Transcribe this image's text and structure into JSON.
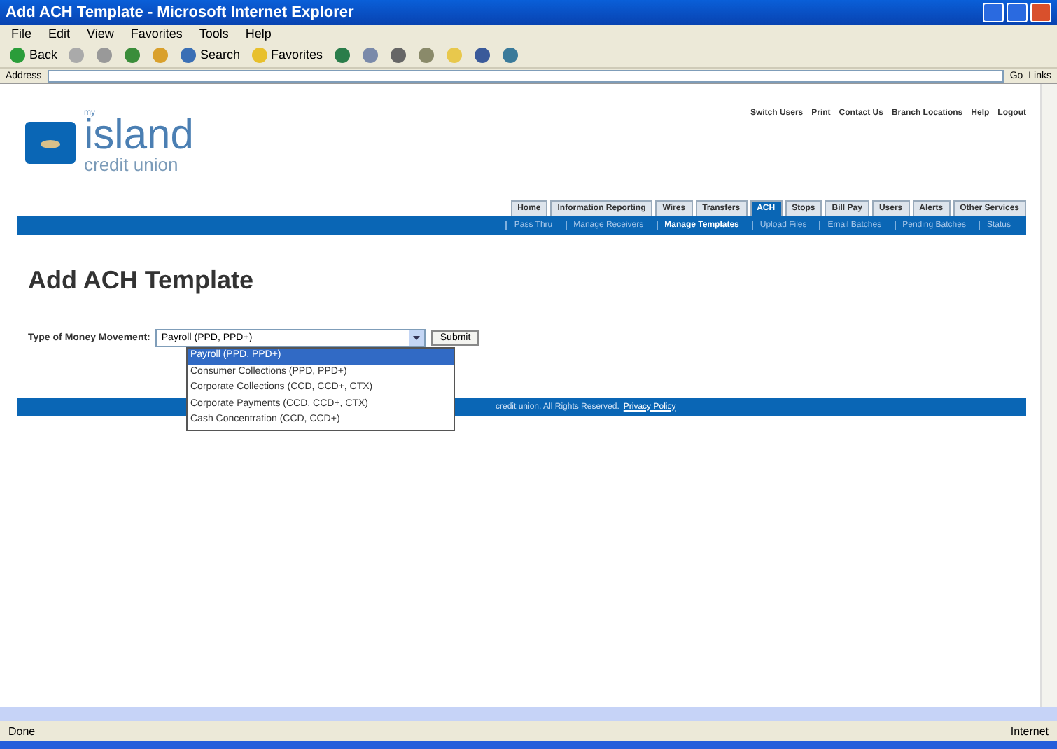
{
  "window": {
    "title": "Add ACH Template - Microsoft Internet Explorer"
  },
  "menu": [
    "File",
    "Edit",
    "View",
    "Favorites",
    "Tools",
    "Help"
  ],
  "toolbar": [
    {
      "kind": "back",
      "label": "Back"
    },
    {
      "kind": "forward"
    },
    {
      "kind": "stop"
    },
    {
      "kind": "refresh"
    },
    {
      "kind": "home"
    },
    {
      "kind": "search",
      "label": "Search"
    },
    {
      "kind": "favorites",
      "label": "Favorites"
    },
    {
      "kind": "media"
    },
    {
      "kind": "mail"
    },
    {
      "kind": "print"
    },
    {
      "kind": "edit"
    },
    {
      "kind": "folder"
    },
    {
      "kind": "messenger"
    },
    {
      "kind": "network"
    }
  ],
  "address": {
    "label": "Address",
    "go": "Go",
    "links": "Links"
  },
  "site": {
    "logo_small": "my",
    "logo_big": "island",
    "logo_sub": "credit union",
    "top_links": [
      "Switch Users",
      "Print",
      "Contact Us",
      "Branch Locations",
      "Help",
      "Logout"
    ],
    "tabs": [
      {
        "label": "Home",
        "selected": false
      },
      {
        "label": "Information Reporting",
        "selected": false
      },
      {
        "label": "Wires",
        "selected": false
      },
      {
        "label": "Transfers",
        "selected": false
      },
      {
        "label": "ACH",
        "selected": true
      },
      {
        "label": "Stops",
        "selected": false
      },
      {
        "label": "Bill Pay",
        "selected": false
      },
      {
        "label": "Users",
        "selected": false
      },
      {
        "label": "Alerts",
        "selected": false
      },
      {
        "label": "Other Services",
        "selected": false
      }
    ],
    "subnav": [
      {
        "label": "Pass Thru",
        "selected": false
      },
      {
        "label": "Manage Receivers",
        "selected": false
      },
      {
        "label": "Manage Templates",
        "selected": true
      },
      {
        "label": "Upload Files",
        "selected": false
      },
      {
        "label": "Email Batches",
        "selected": false
      },
      {
        "label": "Pending Batches",
        "selected": false
      },
      {
        "label": "Status",
        "selected": false
      }
    ]
  },
  "page": {
    "heading": "Add ACH Template",
    "field_label": "Type of Money Movement:",
    "value": "Payroll (PPD, PPD+)",
    "submit": "Submit",
    "options": [
      {
        "label": "Payroll (PPD, PPD+)",
        "selected": true
      },
      {
        "label": "Consumer Collections (PPD, PPD+)",
        "selected": false
      },
      {
        "label": "Corporate Collections (CCD, CCD+, CTX)",
        "selected": false
      },
      {
        "label": "Corporate Payments (CCD, CCD+, CTX)",
        "selected": false
      },
      {
        "label": "Cash Concentration (CCD, CCD+)",
        "selected": false
      }
    ],
    "footer": "credit union. All Rights Reserved.",
    "footer_link": "Privacy Policy"
  },
  "status_bar": {
    "text": "Done",
    "zone": "Internet"
  }
}
